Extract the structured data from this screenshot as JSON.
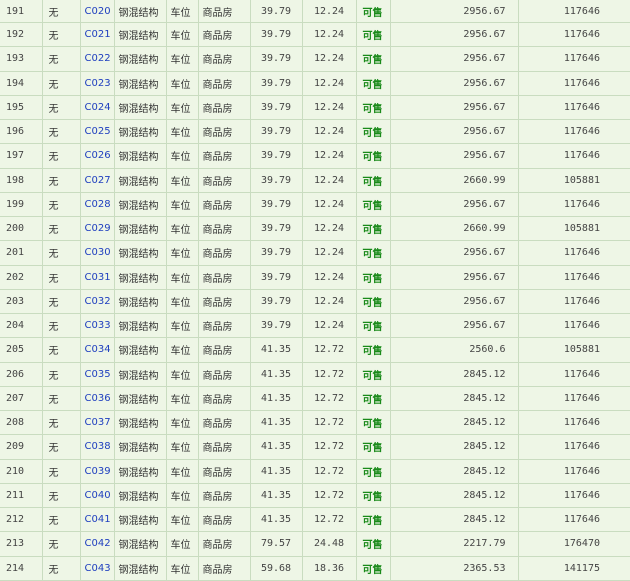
{
  "rows": [
    {
      "idx": "191",
      "c2": "无",
      "unit": "C020",
      "struct": "钢混结构",
      "use": "车位",
      "type": "商品房",
      "area": "39.79",
      "inner": "12.24",
      "status": "可售",
      "price": "2956.67",
      "total": "117646"
    },
    {
      "idx": "192",
      "c2": "无",
      "unit": "C021",
      "struct": "钢混结构",
      "use": "车位",
      "type": "商品房",
      "area": "39.79",
      "inner": "12.24",
      "status": "可售",
      "price": "2956.67",
      "total": "117646"
    },
    {
      "idx": "193",
      "c2": "无",
      "unit": "C022",
      "struct": "钢混结构",
      "use": "车位",
      "type": "商品房",
      "area": "39.79",
      "inner": "12.24",
      "status": "可售",
      "price": "2956.67",
      "total": "117646"
    },
    {
      "idx": "194",
      "c2": "无",
      "unit": "C023",
      "struct": "钢混结构",
      "use": "车位",
      "type": "商品房",
      "area": "39.79",
      "inner": "12.24",
      "status": "可售",
      "price": "2956.67",
      "total": "117646"
    },
    {
      "idx": "195",
      "c2": "无",
      "unit": "C024",
      "struct": "钢混结构",
      "use": "车位",
      "type": "商品房",
      "area": "39.79",
      "inner": "12.24",
      "status": "可售",
      "price": "2956.67",
      "total": "117646"
    },
    {
      "idx": "196",
      "c2": "无",
      "unit": "C025",
      "struct": "钢混结构",
      "use": "车位",
      "type": "商品房",
      "area": "39.79",
      "inner": "12.24",
      "status": "可售",
      "price": "2956.67",
      "total": "117646"
    },
    {
      "idx": "197",
      "c2": "无",
      "unit": "C026",
      "struct": "钢混结构",
      "use": "车位",
      "type": "商品房",
      "area": "39.79",
      "inner": "12.24",
      "status": "可售",
      "price": "2956.67",
      "total": "117646"
    },
    {
      "idx": "198",
      "c2": "无",
      "unit": "C027",
      "struct": "钢混结构",
      "use": "车位",
      "type": "商品房",
      "area": "39.79",
      "inner": "12.24",
      "status": "可售",
      "price": "2660.99",
      "total": "105881"
    },
    {
      "idx": "199",
      "c2": "无",
      "unit": "C028",
      "struct": "钢混结构",
      "use": "车位",
      "type": "商品房",
      "area": "39.79",
      "inner": "12.24",
      "status": "可售",
      "price": "2956.67",
      "total": "117646"
    },
    {
      "idx": "200",
      "c2": "无",
      "unit": "C029",
      "struct": "钢混结构",
      "use": "车位",
      "type": "商品房",
      "area": "39.79",
      "inner": "12.24",
      "status": "可售",
      "price": "2660.99",
      "total": "105881"
    },
    {
      "idx": "201",
      "c2": "无",
      "unit": "C030",
      "struct": "钢混结构",
      "use": "车位",
      "type": "商品房",
      "area": "39.79",
      "inner": "12.24",
      "status": "可售",
      "price": "2956.67",
      "total": "117646"
    },
    {
      "idx": "202",
      "c2": "无",
      "unit": "C031",
      "struct": "钢混结构",
      "use": "车位",
      "type": "商品房",
      "area": "39.79",
      "inner": "12.24",
      "status": "可售",
      "price": "2956.67",
      "total": "117646"
    },
    {
      "idx": "203",
      "c2": "无",
      "unit": "C032",
      "struct": "钢混结构",
      "use": "车位",
      "type": "商品房",
      "area": "39.79",
      "inner": "12.24",
      "status": "可售",
      "price": "2956.67",
      "total": "117646"
    },
    {
      "idx": "204",
      "c2": "无",
      "unit": "C033",
      "struct": "钢混结构",
      "use": "车位",
      "type": "商品房",
      "area": "39.79",
      "inner": "12.24",
      "status": "可售",
      "price": "2956.67",
      "total": "117646"
    },
    {
      "idx": "205",
      "c2": "无",
      "unit": "C034",
      "struct": "钢混结构",
      "use": "车位",
      "type": "商品房",
      "area": "41.35",
      "inner": "12.72",
      "status": "可售",
      "price": "2560.6",
      "total": "105881"
    },
    {
      "idx": "206",
      "c2": "无",
      "unit": "C035",
      "struct": "钢混结构",
      "use": "车位",
      "type": "商品房",
      "area": "41.35",
      "inner": "12.72",
      "status": "可售",
      "price": "2845.12",
      "total": "117646"
    },
    {
      "idx": "207",
      "c2": "无",
      "unit": "C036",
      "struct": "钢混结构",
      "use": "车位",
      "type": "商品房",
      "area": "41.35",
      "inner": "12.72",
      "status": "可售",
      "price": "2845.12",
      "total": "117646"
    },
    {
      "idx": "208",
      "c2": "无",
      "unit": "C037",
      "struct": "钢混结构",
      "use": "车位",
      "type": "商品房",
      "area": "41.35",
      "inner": "12.72",
      "status": "可售",
      "price": "2845.12",
      "total": "117646"
    },
    {
      "idx": "209",
      "c2": "无",
      "unit": "C038",
      "struct": "钢混结构",
      "use": "车位",
      "type": "商品房",
      "area": "41.35",
      "inner": "12.72",
      "status": "可售",
      "price": "2845.12",
      "total": "117646"
    },
    {
      "idx": "210",
      "c2": "无",
      "unit": "C039",
      "struct": "钢混结构",
      "use": "车位",
      "type": "商品房",
      "area": "41.35",
      "inner": "12.72",
      "status": "可售",
      "price": "2845.12",
      "total": "117646"
    },
    {
      "idx": "211",
      "c2": "无",
      "unit": "C040",
      "struct": "钢混结构",
      "use": "车位",
      "type": "商品房",
      "area": "41.35",
      "inner": "12.72",
      "status": "可售",
      "price": "2845.12",
      "total": "117646"
    },
    {
      "idx": "212",
      "c2": "无",
      "unit": "C041",
      "struct": "钢混结构",
      "use": "车位",
      "type": "商品房",
      "area": "41.35",
      "inner": "12.72",
      "status": "可售",
      "price": "2845.12",
      "total": "117646"
    },
    {
      "idx": "213",
      "c2": "无",
      "unit": "C042",
      "struct": "钢混结构",
      "use": "车位",
      "type": "商品房",
      "area": "79.57",
      "inner": "24.48",
      "status": "可售",
      "price": "2217.79",
      "total": "176470"
    },
    {
      "idx": "214",
      "c2": "无",
      "unit": "C043",
      "struct": "钢混结构",
      "use": "车位",
      "type": "商品房",
      "area": "59.68",
      "inner": "18.36",
      "status": "可售",
      "price": "2365.53",
      "total": "141175"
    }
  ]
}
